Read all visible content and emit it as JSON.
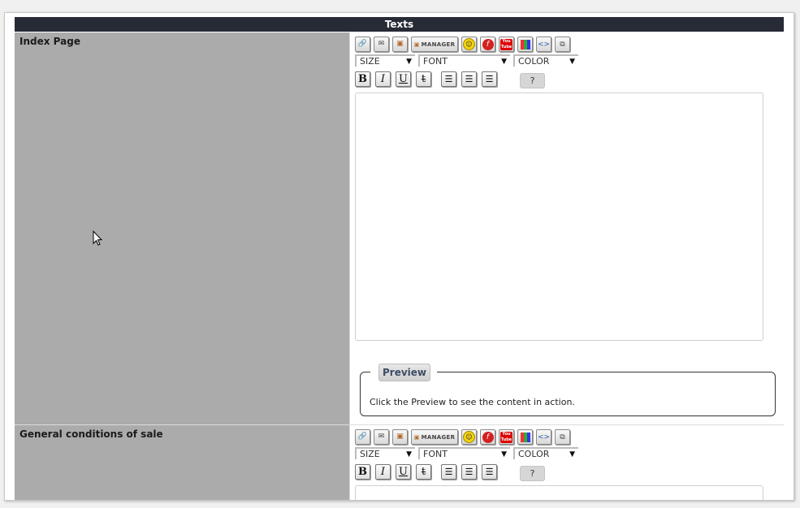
{
  "header": {
    "title": "Texts"
  },
  "toolbar": {
    "manager_label": "MANAGER",
    "size_label": "SIZE",
    "font_label": "FONT",
    "color_label": "COLOR",
    "help_label": "?",
    "bold": "B",
    "italic": "I",
    "underline": "U",
    "strike": "t"
  },
  "sections": [
    {
      "label": "Index Page",
      "preview_button": "Preview",
      "preview_text": "Click the Preview to see the content in action."
    },
    {
      "label": "General conditions of sale"
    }
  ],
  "colors": {
    "header_bg": "#272b35",
    "label_bg": "#ababab",
    "preview_text": "#3c4c64"
  }
}
